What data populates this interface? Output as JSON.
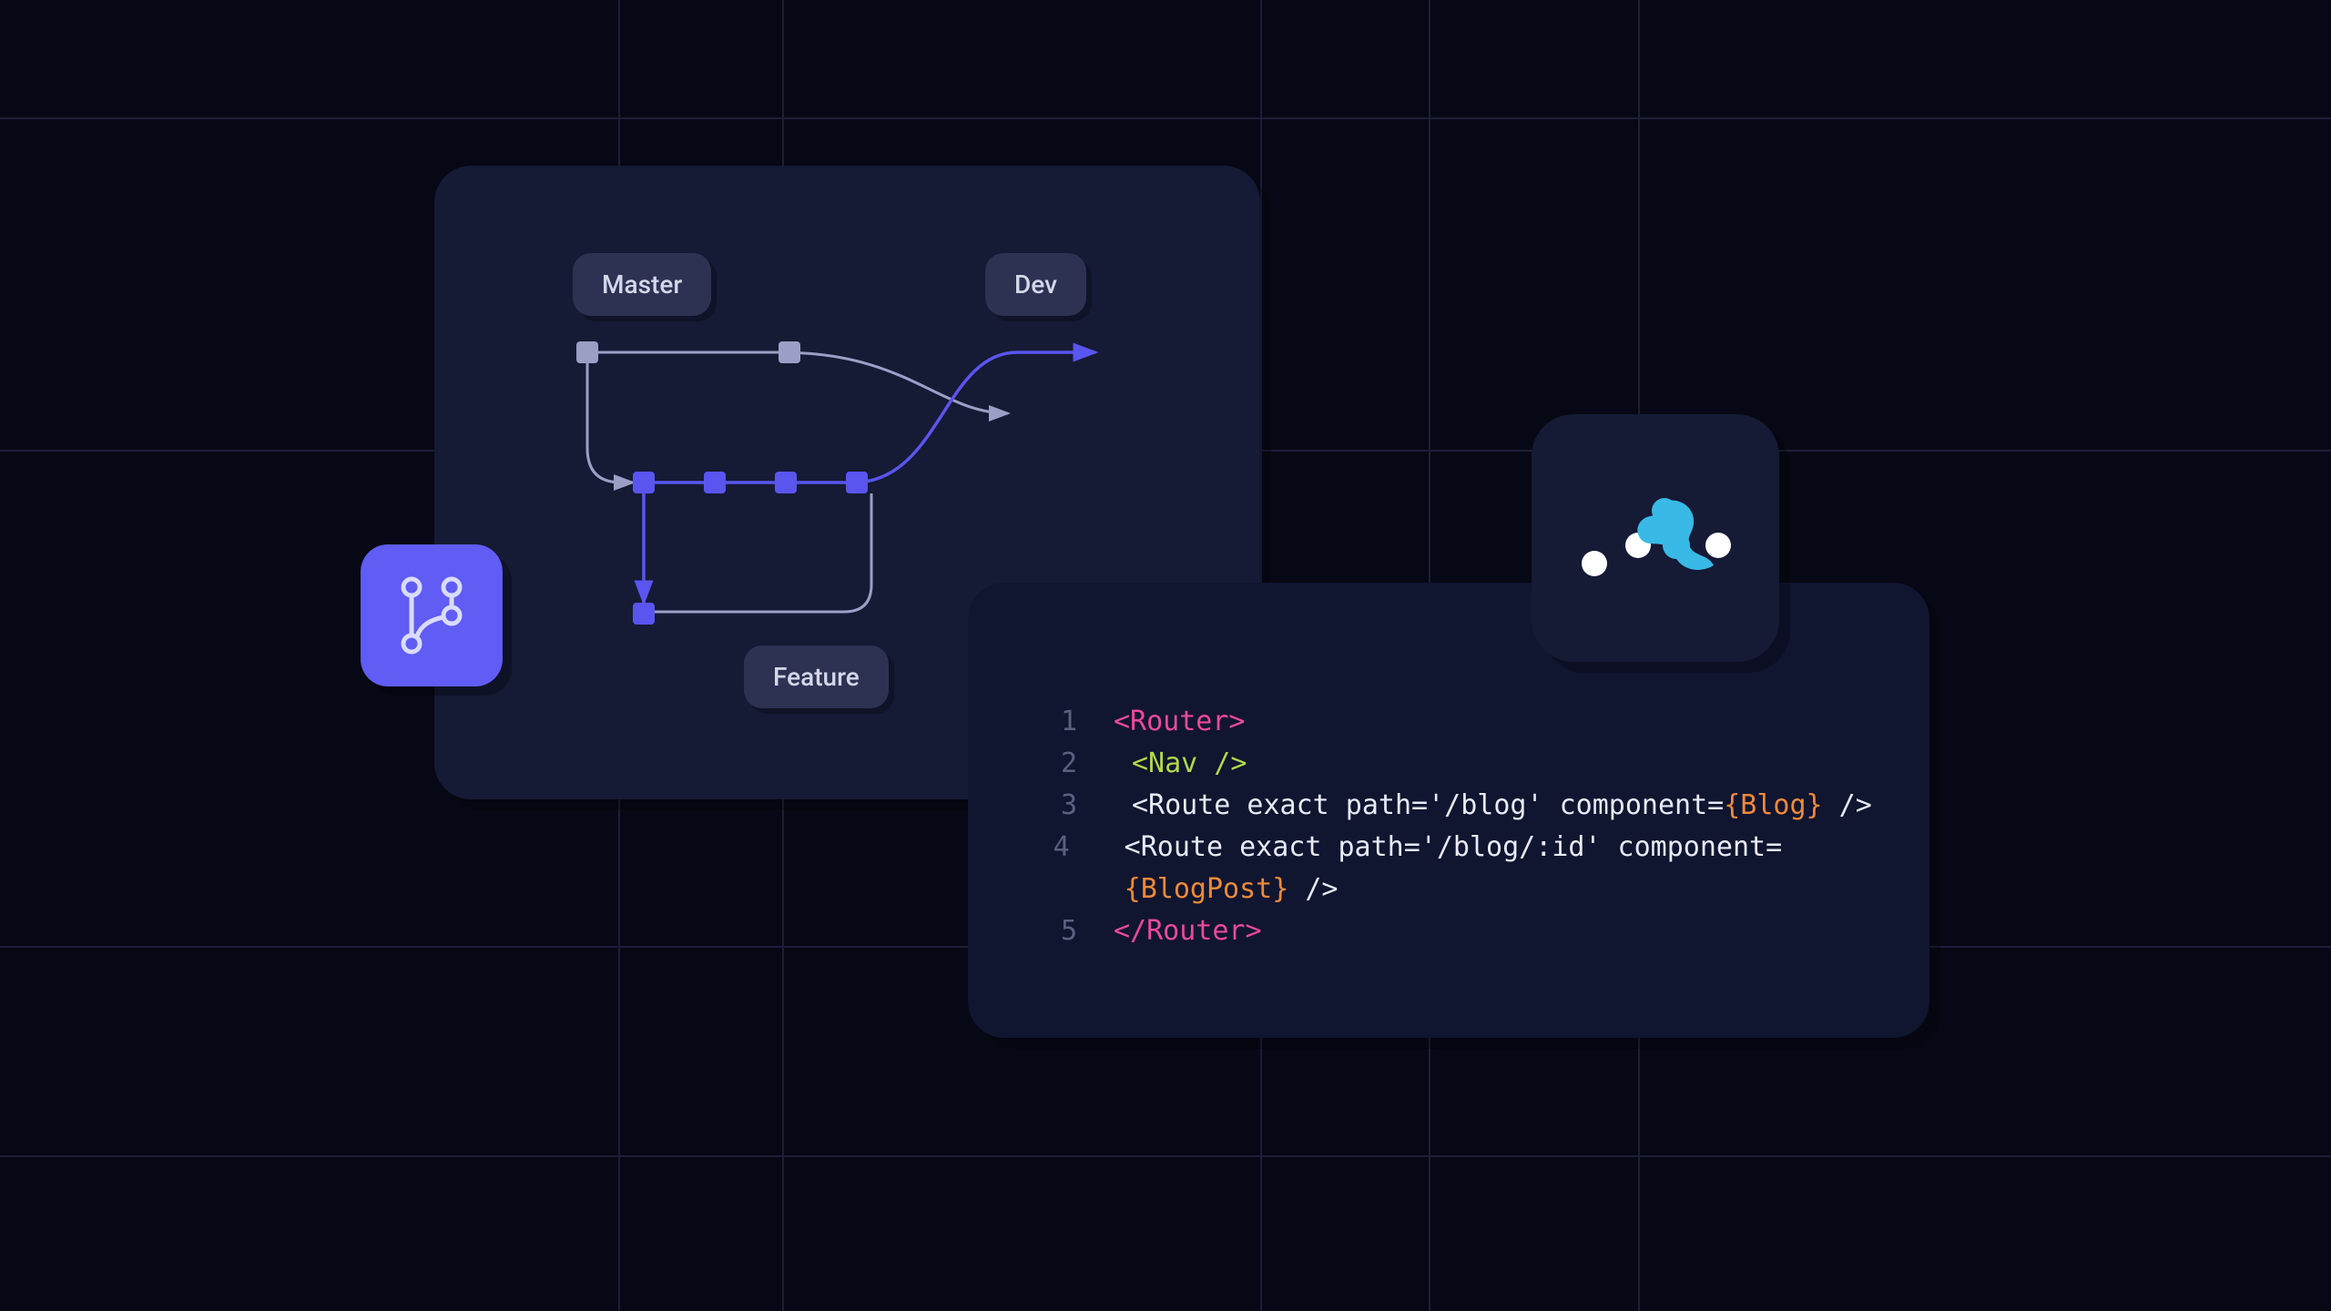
{
  "git": {
    "labels": {
      "master": "Master",
      "dev": "Dev",
      "feature": "Feature"
    },
    "icon": "git-branch-icon"
  },
  "router_badge": {
    "icon": "react-router-icon"
  },
  "colors": {
    "bg": "#070815",
    "panel": "#151a35",
    "accent": "#605cf4",
    "pink": "#ea4a99",
    "green": "#b0d94a",
    "white": "#e8ebf7",
    "orange": "#f08a3a",
    "cyan": "#39b9e6"
  },
  "code": {
    "lines": [
      {
        "n": "1",
        "indent": 0,
        "tokens": [
          {
            "cls": "pink",
            "text": "<Router>"
          }
        ]
      },
      {
        "n": "2",
        "indent": 1,
        "tokens": [
          {
            "cls": "green",
            "text": "<Nav />"
          }
        ]
      },
      {
        "n": "3",
        "indent": 1,
        "tokens": [
          {
            "cls": "white",
            "text": "<Route exact path='/blog' component="
          },
          {
            "cls": "orange",
            "text": "{Blog}"
          },
          {
            "cls": "white",
            "text": " />"
          }
        ]
      },
      {
        "n": "4",
        "indent": 1,
        "tokens": [
          {
            "cls": "white",
            "text": "<Route exact path='/blog/:id' component="
          },
          {
            "cls": "orange",
            "text": "{BlogPost}"
          },
          {
            "cls": "white",
            "text": " />"
          }
        ]
      },
      {
        "n": "5",
        "indent": 0,
        "tokens": [
          {
            "cls": "pink",
            "text": "</Router>"
          }
        ]
      }
    ]
  }
}
